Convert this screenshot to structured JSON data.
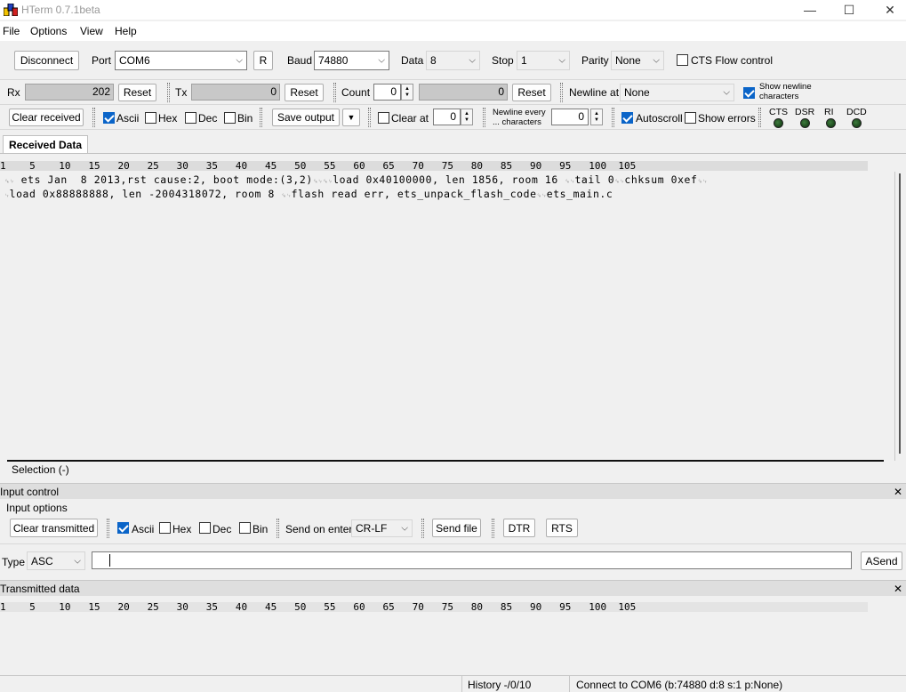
{
  "window": {
    "title": "HTerm 0.7.1beta",
    "minimize": "—",
    "maximize": "☐",
    "close": "✕"
  },
  "menu": [
    "File",
    "Options",
    "View",
    "Help"
  ],
  "connection": {
    "disconnect_label": "Disconnect",
    "port_label": "Port",
    "port_value": "COM6",
    "r_label": "R",
    "baud_label": "Baud",
    "baud_value": "74880",
    "data_label": "Data",
    "data_value": "8",
    "stop_label": "Stop",
    "stop_value": "1",
    "parity_label": "Parity",
    "parity_value": "None",
    "cts_flow_label": "CTS Flow control"
  },
  "counters": {
    "rx_label": "Rx",
    "rx_value": "202",
    "rx_reset": "Reset",
    "tx_label": "Tx",
    "tx_value": "0",
    "tx_reset": "Reset",
    "count_label": "Count",
    "count_value": "0",
    "count_field": "0",
    "count_reset": "Reset",
    "newline_at_label": "Newline at",
    "newline_at_value": "None",
    "show_newline_label_1": "Show newline",
    "show_newline_label_2": "characters"
  },
  "receive_options": {
    "clear_received": "Clear received",
    "ascii": "Ascii",
    "hex": "Hex",
    "dec": "Dec",
    "bin": "Bin",
    "save_output": "Save output",
    "clear_at": "Clear at",
    "clear_at_value": "0",
    "newline_every_1": "Newline every",
    "newline_every_2": "... characters",
    "newline_every_value": "0",
    "autoscroll": "Autoscroll",
    "show_errors": "Show errors",
    "signals": [
      "CTS",
      "DSR",
      "RI",
      "DCD"
    ]
  },
  "received": {
    "tab": "Received Data",
    "ruler": "1    5    10   15   20   25   30   35   40   45   50   55   60   65   70   75   80   85   90   95   100  105",
    "line1_nl": "␍␊",
    "line1_a": " ets Jan  8 2013,rst cause:2, boot mode:(3,2)",
    "line1_nl2": "␍␊␍␊",
    "line1_b": "load 0x40100000, len 1856, room 16 ",
    "line1_nl3": "␍␊",
    "line1_c": "tail 0",
    "line1_nl4": "␍␊",
    "line1_d": "chksum 0xef",
    "line1_nl5": "␍␊",
    "line2_nl": "␊",
    "line2_a": "load 0x88888888, len -2004318072, room 8 ",
    "line2_nl2": "␍␊",
    "line2_b": "flash read err, ets_unpack_flash_code",
    "line2_nl3": "␍␊",
    "line2_c": "ets_main.c",
    "selection": "Selection (-)"
  },
  "input_control": {
    "header": "Input control",
    "close": "✕",
    "options_label": "Input options",
    "clear_transmitted": "Clear transmitted",
    "ascii": "Ascii",
    "hex": "Hex",
    "dec": "Dec",
    "bin": "Bin",
    "send_on_enter_label": "Send on enter",
    "send_on_enter_value": "CR-LF",
    "send_file": "Send file",
    "dtr": "DTR",
    "rts": "RTS",
    "type_label": "Type",
    "type_value": "ASC",
    "input_value": "",
    "asend": "ASend"
  },
  "transmitted": {
    "header": "Transmitted data",
    "close": "✕",
    "ruler": "1    5    10   15   20   25   30   35   40   45   50   55   60   65   70   75   80   85   90   95   100  105"
  },
  "status": {
    "history": "History -/0/10",
    "connection": "Connect to COM6 (b:74880 d:8 s:1 p:None)"
  },
  "colors": {
    "checkbox_on": "#0a64c8",
    "led_off": "#0c300c"
  }
}
